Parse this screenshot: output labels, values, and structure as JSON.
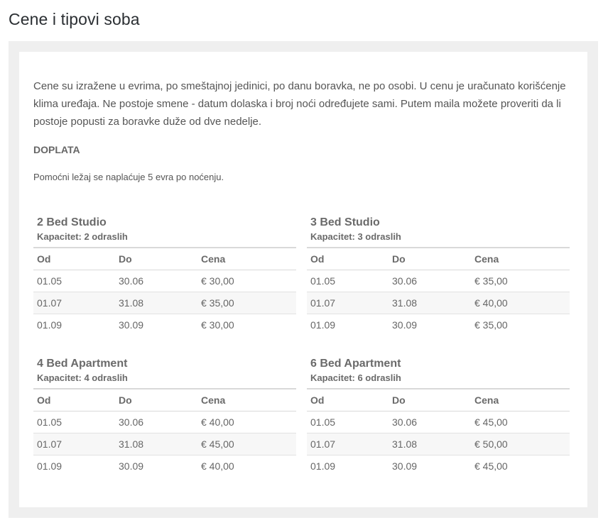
{
  "page": {
    "title": "Cene i tipovi soba"
  },
  "content": {
    "intro": "Cene su izražene u evrima, po smeštajnoj jedinici, po danu boravka, ne po osobi. U cenu je uračunato korišćenje klima uređaja. Ne postoje smene - datum dolaska i broj noći određujete sami. Putem maila možete proveriti da li postoje popusti za boravke duže od dve nedelje.",
    "section_title": "DOPLATA",
    "note": "Pomoćni ležaj se naplaćuje 5 evra po noćenju."
  },
  "table_headers": {
    "from": "Od",
    "to": "Do",
    "price": "Cena"
  },
  "rooms": [
    {
      "name": "2 Bed Studio",
      "capacity": "Kapacitet: 2 odraslih",
      "rows": [
        {
          "from": "01.05",
          "to": "30.06",
          "price": "€ 30,00"
        },
        {
          "from": "01.07",
          "to": "31.08",
          "price": "€ 35,00"
        },
        {
          "from": "01.09",
          "to": "30.09",
          "price": "€ 30,00"
        }
      ]
    },
    {
      "name": "3 Bed Studio",
      "capacity": "Kapacitet: 3 odraslih",
      "rows": [
        {
          "from": "01.05",
          "to": "30.06",
          "price": "€ 35,00"
        },
        {
          "from": "01.07",
          "to": "31.08",
          "price": "€ 40,00"
        },
        {
          "from": "01.09",
          "to": "30.09",
          "price": "€ 35,00"
        }
      ]
    },
    {
      "name": "4 Bed Apartment",
      "capacity": "Kapacitet: 4 odraslih",
      "rows": [
        {
          "from": "01.05",
          "to": "30.06",
          "price": "€ 40,00"
        },
        {
          "from": "01.07",
          "to": "31.08",
          "price": "€ 45,00"
        },
        {
          "from": "01.09",
          "to": "30.09",
          "price": "€ 40,00"
        }
      ]
    },
    {
      "name": "6 Bed Apartment",
      "capacity": "Kapacitet: 6 odraslih",
      "rows": [
        {
          "from": "01.05",
          "to": "30.06",
          "price": "€ 45,00"
        },
        {
          "from": "01.07",
          "to": "31.08",
          "price": "€ 50,00"
        },
        {
          "from": "01.09",
          "to": "30.09",
          "price": "€ 45,00"
        }
      ]
    }
  ]
}
